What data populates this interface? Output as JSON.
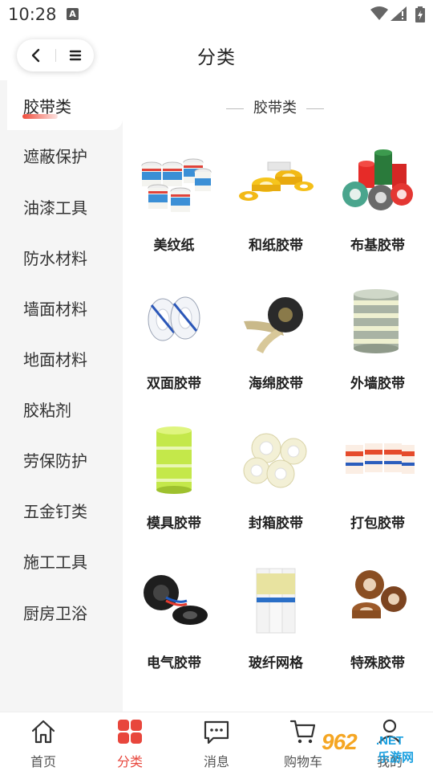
{
  "status": {
    "time": "10:28",
    "notification_badge": "A"
  },
  "header": {
    "title": "分类"
  },
  "sidebar": {
    "items": [
      {
        "label": "胶带类",
        "active": true
      },
      {
        "label": "遮蔽保护"
      },
      {
        "label": "油漆工具"
      },
      {
        "label": "防水材料"
      },
      {
        "label": "墙面材料"
      },
      {
        "label": "地面材料"
      },
      {
        "label": "胶粘剂"
      },
      {
        "label": "劳保防护"
      },
      {
        "label": "五金钉类"
      },
      {
        "label": "施工工具"
      },
      {
        "label": "厨房卫浴"
      }
    ]
  },
  "main": {
    "section_title": "胶带类",
    "products": [
      {
        "name": "美纹纸",
        "icon": "masking-paper-rolls"
      },
      {
        "name": "和纸胶带",
        "icon": "washi-tape-rolls"
      },
      {
        "name": "布基胶带",
        "icon": "cloth-tape-rolls"
      },
      {
        "name": "双面胶带",
        "icon": "double-sided-tape-rolls"
      },
      {
        "name": "海绵胶带",
        "icon": "foam-tape-roll"
      },
      {
        "name": "外墙胶带",
        "icon": "exterior-wall-tape-stack"
      },
      {
        "name": "模具胶带",
        "icon": "mold-tape-roll"
      },
      {
        "name": "封箱胶带",
        "icon": "packing-tape-rolls"
      },
      {
        "name": "打包胶带",
        "icon": "printed-packing-tape-rolls"
      },
      {
        "name": "电气胶带",
        "icon": "electrical-tape-rolls"
      },
      {
        "name": "玻纤网格",
        "icon": "fiberglass-mesh-rolls"
      },
      {
        "name": "特殊胶带",
        "icon": "special-brown-tape-rolls"
      }
    ]
  },
  "tabbar": {
    "tabs": [
      {
        "label": "首页",
        "icon": "home-icon"
      },
      {
        "label": "分类",
        "icon": "category-icon",
        "active": true
      },
      {
        "label": "消息",
        "icon": "message-icon"
      },
      {
        "label": "购物车",
        "icon": "cart-icon"
      },
      {
        "label": "我的",
        "icon": "user-icon"
      }
    ]
  },
  "watermark": {
    "number": "962",
    "suffix": ".NET",
    "site": "乐游网"
  },
  "colors": {
    "accent": "#e8463c",
    "sidebar_bg": "#f5f5f5"
  }
}
